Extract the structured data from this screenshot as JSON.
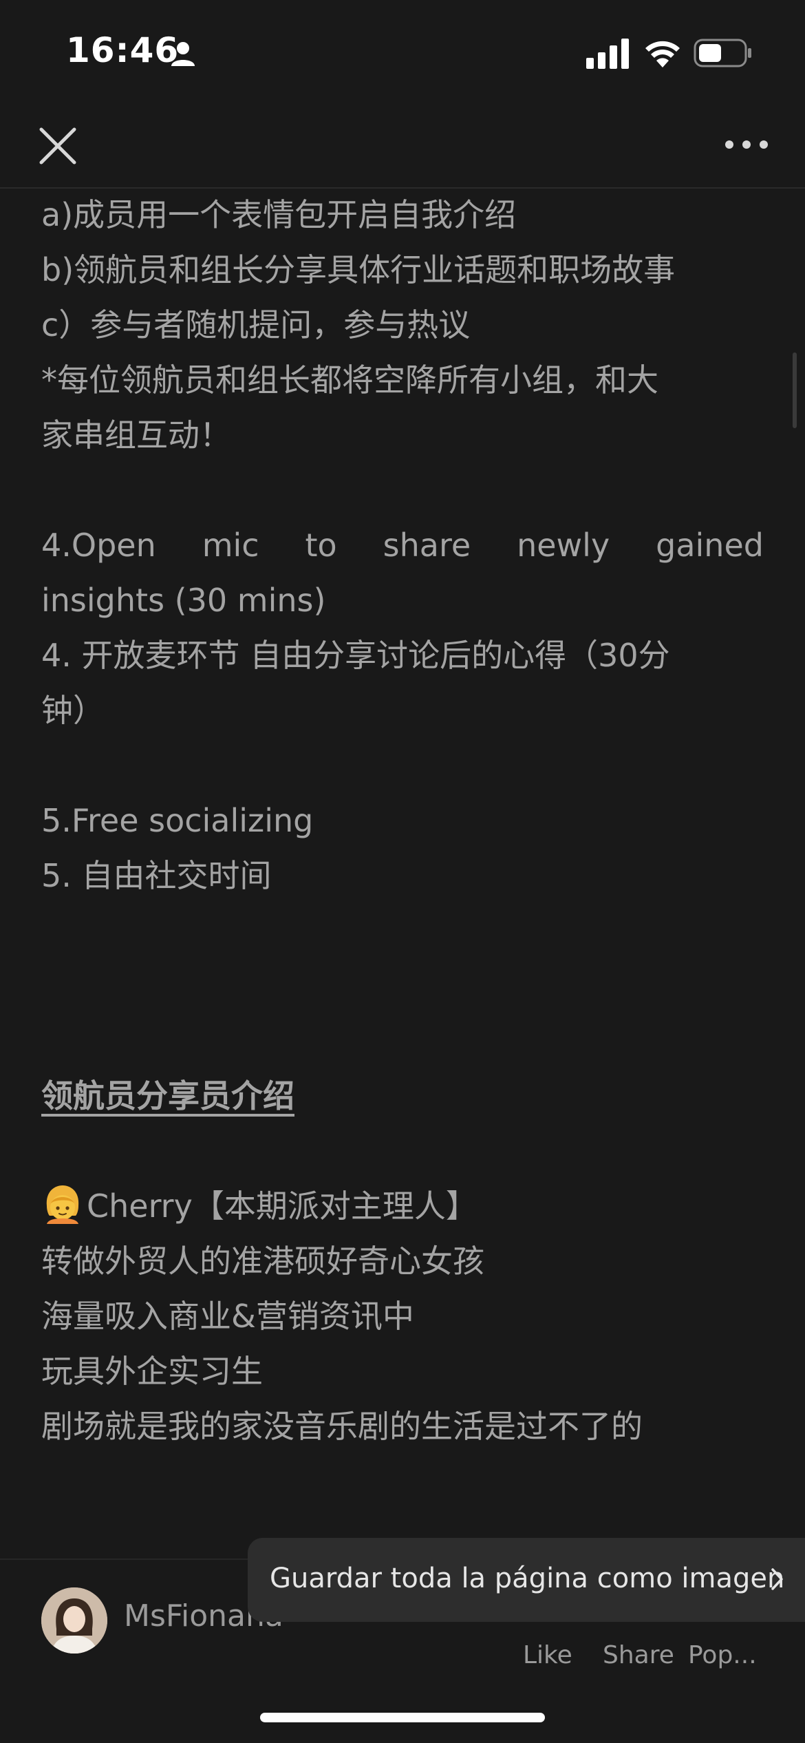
{
  "status_bar": {
    "time": "16:46",
    "icons": [
      "person-icon",
      "signal-icon",
      "wifi-icon",
      "battery-icon"
    ]
  },
  "nav": {
    "close_icon": "close-icon",
    "more_icon": "more-icon"
  },
  "content": {
    "lines": {
      "l1": "a)成员用一个表情包开启自我介绍",
      "l2": "b)领航员和组长分享具体行业话题和职场故事",
      "l3": "c）参与者随机提问，参与热议",
      "l4": "*每位领航员和组长都将空降所有小组，和大",
      "l5": "家串组互动！",
      "l6a": "4.Open",
      "l6b": "mic",
      "l6c": "to",
      "l6d": "share",
      "l6e": "newly",
      "l6f": "gained",
      "l7": "insights (30 mins)",
      "l8": "4. 开放麦环节 自由分享讨论后的心得（30分",
      "l9": "钟）",
      "l10": "5.Free socializing",
      "l11": "5. 自由社交时间",
      "heading": "领航员分享员介绍",
      "l12": "Cherry【本期派对主理人】",
      "l13": "转做外贸人的准港硕好奇心女孩",
      "l14": "海量吸入商业&营销资讯中",
      "l15": "玩具外企实习生",
      "l16": "剧场就是我的家没音乐剧的生活是过不了的"
    },
    "emoji_icon": "girl-emoji-icon"
  },
  "footer": {
    "author": "MsFionana",
    "actions": {
      "like": "Like",
      "share": "Share",
      "pop": "Pop..."
    }
  },
  "toast": {
    "text": "Guardar toda la página como imagen"
  },
  "colors": {
    "background": "#191919",
    "text": "#a4a4a4",
    "toast_bg": "#2d2d2d"
  }
}
